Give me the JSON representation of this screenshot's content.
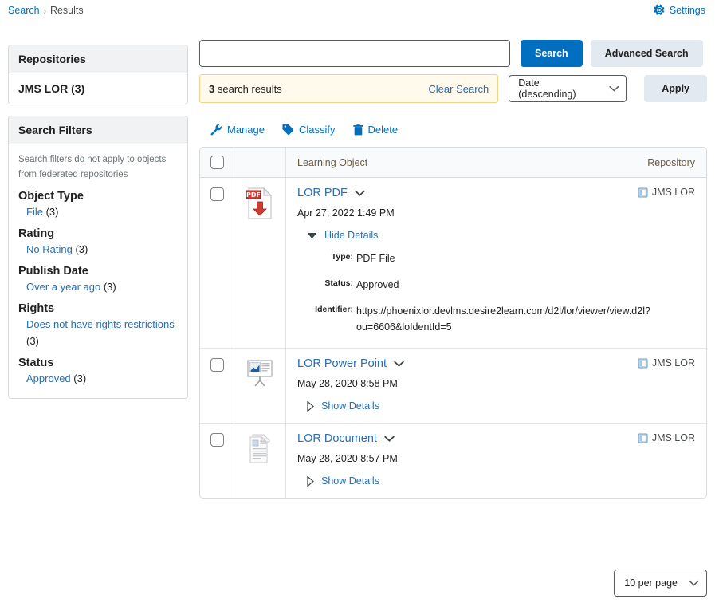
{
  "breadcrumb": {
    "root": "Search",
    "separator": "›",
    "current": "Results"
  },
  "settings": {
    "label": "Settings",
    "icon": "gear-icon",
    "color": "#006fbf"
  },
  "repositories": {
    "title": "Repositories",
    "items": [
      {
        "label": "JMS LOR (3)"
      }
    ]
  },
  "filters": {
    "title": "Search Filters",
    "note": "Search filters do not apply to objects from federated repositories",
    "groups": [
      {
        "title": "Object Type",
        "options": [
          {
            "label": "File",
            "count": "(3)"
          }
        ]
      },
      {
        "title": "Rating",
        "options": [
          {
            "label": "No Rating",
            "count": "(3)"
          }
        ]
      },
      {
        "title": "Publish Date",
        "options": [
          {
            "label": "Over a year ago",
            "count": "(3)"
          }
        ]
      },
      {
        "title": "Rights",
        "options": [
          {
            "label": "Does not have rights restrictions",
            "count": "(3)"
          }
        ]
      },
      {
        "title": "Status",
        "options": [
          {
            "label": "Approved",
            "count": "(3)"
          }
        ]
      }
    ]
  },
  "search": {
    "value": "",
    "placeholder": "",
    "search_button": "Search",
    "advanced_button": "Advanced Search",
    "results_count": "3",
    "results_text": "search results",
    "clear_label": "Clear Search",
    "sort_value": "Date (descending)",
    "apply_button": "Apply"
  },
  "toolbar": {
    "manage": "Manage",
    "classify": "Classify",
    "delete": "Delete"
  },
  "table": {
    "header": {
      "learning_object": "Learning Object",
      "repository": "Repository"
    },
    "rows": [
      {
        "title": "LOR PDF",
        "icon": "pdf-file-icon",
        "date": "Apr 27, 2022 1:49 PM",
        "repository": "JMS LOR",
        "details_toggle": "Hide Details",
        "expanded": true,
        "details": [
          {
            "label": "Type:",
            "value": "PDF File"
          },
          {
            "label": "Status:",
            "value": "Approved"
          },
          {
            "label": "Identifier:",
            "value": "https://phoenixlor.devlms.desire2learn.com/d2l/lor/viewer/view.d2l?ou=6606&loIdentId=5"
          }
        ]
      },
      {
        "title": "LOR Power Point",
        "icon": "powerpoint-file-icon",
        "date": "May 28, 2020 8:58 PM",
        "repository": "JMS LOR",
        "details_toggle": "Show Details",
        "expanded": false,
        "details": []
      },
      {
        "title": "LOR Document",
        "icon": "document-file-icon",
        "date": "May 28, 2020 8:57 PM",
        "repository": "JMS LOR",
        "details_toggle": "Show Details",
        "expanded": false,
        "details": []
      }
    ]
  },
  "pagination": {
    "per_page": "10 per page"
  },
  "colors": {
    "primary": "#006fbf",
    "link": "#2b6dad",
    "banner_bg": "#fffaec",
    "banner_border": "#f2d188"
  }
}
